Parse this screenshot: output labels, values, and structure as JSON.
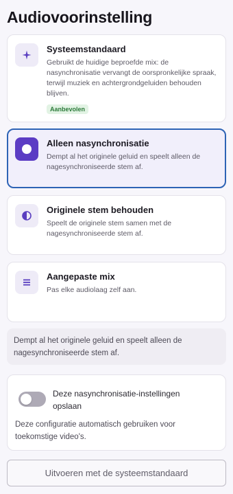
{
  "page": {
    "title": "Audiovoorinstelling"
  },
  "options": [
    {
      "icon": "sparkle-icon",
      "title": "Systeemstandaard",
      "description": "Gebruikt de huidige beproefde mix: de nasynchronisatie vervangt de oorspronkelijke spraak, terwijl muziek en achtergrondgeluiden behouden blijven.",
      "badge": "Aanbevolen",
      "selected": false
    },
    {
      "icon": "circle-icon",
      "title": "Alleen nasynchronisatie",
      "description": "Dempt al het originele geluid en speelt alleen de nagesynchroniseerde stem af.",
      "selected": true
    },
    {
      "icon": "half-circle-icon",
      "title": "Originele stem behouden",
      "description": "Speelt de originele stem samen met de nagesynchroniseerde stem af.",
      "selected": false
    },
    {
      "icon": "list-icon",
      "title": "Aangepaste mix",
      "description": "Pas elke audiolaag zelf aan.",
      "selected": false
    }
  ],
  "info": {
    "text": "Dempt al het originele geluid en speelt alleen de nagesynchroniseerde stem af."
  },
  "settings": {
    "toggle_label": "Deze nasynchronisatie-instellingen opslaan",
    "toggle_on": false,
    "description": "Deze configuratie automatisch gebruiken voor toekomstige video's."
  },
  "actions": {
    "run_label": "Uitvoeren met de systeemstandaard"
  },
  "colors": {
    "accent": "#5b3cc4",
    "selected_border": "#2d63b5",
    "badge_bg": "#e2f3e4",
    "badge_text": "#2c7a3a"
  }
}
